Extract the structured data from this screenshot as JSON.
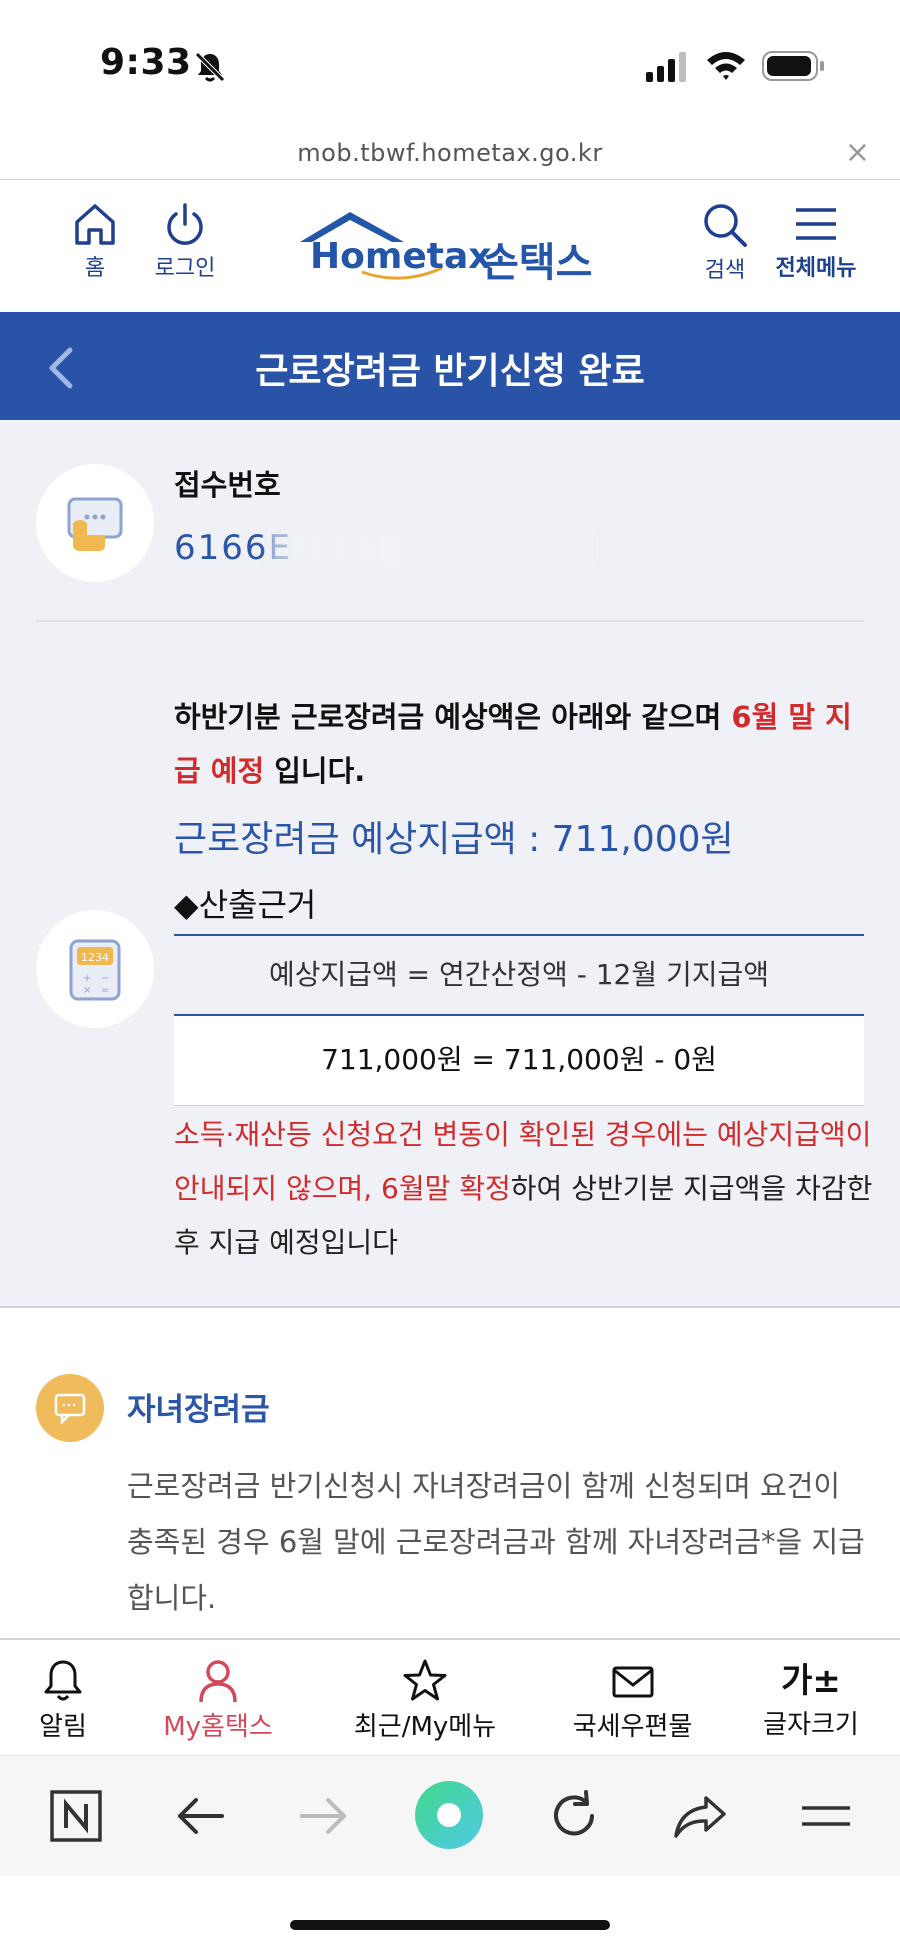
{
  "status_bar": {
    "time": "9:33"
  },
  "browser": {
    "url": "mob.tbwf.hometax.go.kr",
    "close_symbol": "×"
  },
  "header": {
    "home_label": "홈",
    "login_label": "로그인",
    "logo_text": "Hometax",
    "logo_korean": "손택스",
    "search_label": "검색",
    "menu_label": "전체메뉴"
  },
  "page": {
    "title": "근로장려금 반기신청 완료"
  },
  "receipt": {
    "label": "접수번호",
    "number": "6166E"
  },
  "result": {
    "main_text_1": "하반기분 근로장려금 예상액은 아래와 같으며 ",
    "main_text_red": "6월 말 지급 예정",
    "main_text_2": " 입니다.",
    "amount": "근로장려금 예상지급액 : 711,000원",
    "basis_title": "◆산출근거",
    "formula_header": "예상지급액 = 연간산정액 - 12월 기지급액",
    "formula_value": "711,000원 = 711,000원 - 0원",
    "notice_red": "소득·재산등 신청요건 변동이 확인된 경우에는 예상지급액이 안내되지 않으며, 6월말 확정",
    "notice_rest": "하여 상반기분 지급액을 차감한 후 지급 예정입니다"
  },
  "child_section": {
    "title": "자녀장려금",
    "description": "근로장려금 반기신청시 자녀장려금이 함께 신청되며 요건이 충족된 경우 6월 말에 근로장려금과 함께 자녀장려금*을 지급합니다."
  },
  "bottom_nav": {
    "alarm": "알림",
    "my_hometax": "My홈택스",
    "recent": "최근/My메뉴",
    "mail": "국세우편물",
    "font_glyph": "가±",
    "font_size": "글자크기"
  },
  "calc_icon_text": "1234",
  "colors": {
    "primary": "#2853a6",
    "accent_red": "#d12b2b",
    "my_hometax": "#d14a5a",
    "child_icon": "#efbb5c",
    "content_bg": "#eff1f7"
  }
}
